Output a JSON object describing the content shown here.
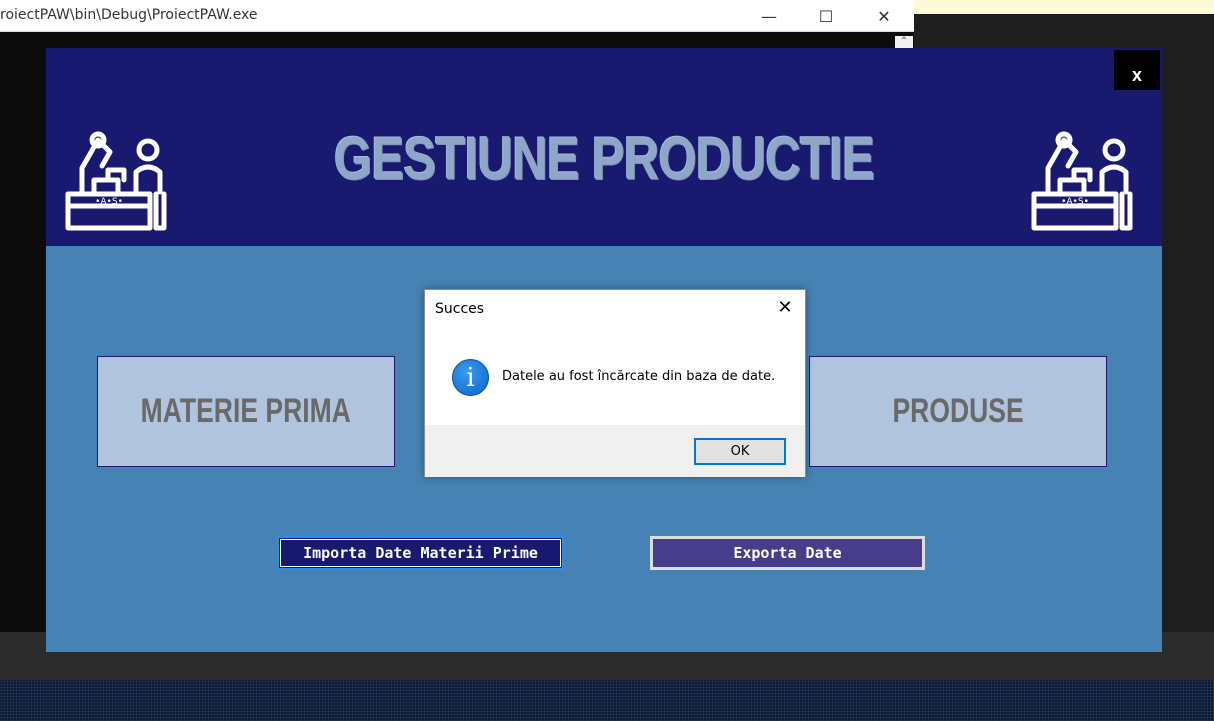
{
  "console": {
    "title": "roiectPAW\\bin\\Debug\\ProiectPAW.exe",
    "minimize_glyph": "—",
    "maximize_glyph": "☐",
    "close_glyph": "✕",
    "scroll_up_glyph": "⌃"
  },
  "form": {
    "title": "GESTIUNE PRODUCTIE",
    "close_label": "x",
    "buttons": {
      "materie_prima": "MATERIE PRIMA",
      "produse": "PRODUSE",
      "importa": "Importa Date Materii Prime",
      "exporta": "Exporta Date"
    },
    "icons": {
      "header_left": "factory-robot-worker-icon",
      "header_right": "factory-robot-worker-icon"
    },
    "colors": {
      "header": "#191970",
      "body": "#4682b4",
      "big_button": "#b0c4de",
      "importa_button": "#191970",
      "exporta_button": "#483d8b"
    }
  },
  "msgbox": {
    "title": "Succes",
    "close_glyph": "✕",
    "icon": "info-icon",
    "icon_glyph": "i",
    "message": "Datele au fost încărcate din baza de date.",
    "ok_label": "OK"
  }
}
